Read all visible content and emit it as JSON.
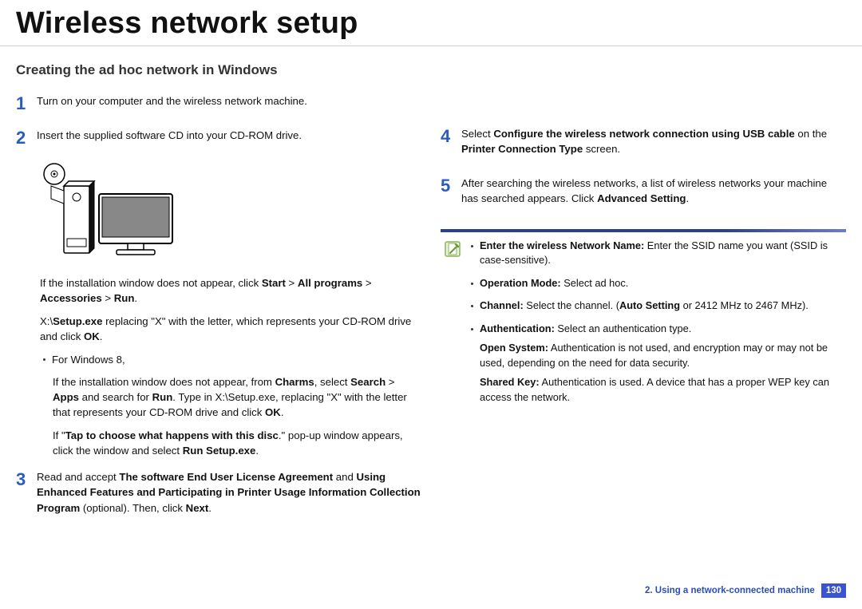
{
  "title": "Wireless network setup",
  "subheading": "Creating the ad hoc network in Windows",
  "left": {
    "step1": {
      "num": "1",
      "text": "Turn on your computer and the wireless network machine."
    },
    "step2": {
      "num": "2",
      "text": "Insert the supplied software CD into your CD-ROM drive."
    },
    "afterInstall_pre": "If the installation window does not appear, click ",
    "afterInstall_bold1": "Start",
    "gt": " > ",
    "afterInstall_bold2": "All programs",
    "afterInstall_bold3": "Accessories",
    "afterInstall_bold4": "Run",
    "period": ".",
    "setupexe_pre": " X:\\",
    "setupexe_bold": "Setup.exe",
    "setupexe_post": " replacing \"X\" with the letter, which represents your CD-ROM drive and click ",
    "ok": "OK",
    "win8_label": "For Windows 8,",
    "win8_p1_a": "If the installation window does not appear, from ",
    "win8_p1_b": "Charms",
    "win8_p1_c": ", select ",
    "win8_p1_d": "Search",
    "win8_p1_e": "Apps",
    "win8_p1_f": " and search for ",
    "win8_p1_g": "Run",
    "win8_p1_h": ". Type in X:\\Setup.exe, replacing \"X\" with the letter that represents your CD-ROM drive and click ",
    "win8_p2_a": "If \"",
    "win8_p2_b": "Tap to choose what happens with this disc",
    "win8_p2_c": ".\" pop-up window appears, click the window and select ",
    "win8_p2_d": "Run Setup.exe",
    "step3": {
      "num": "3",
      "a": "Read and accept ",
      "b": "The software End User License Agreement",
      "c": "  and ",
      "d": "Using Enhanced Features and Participating in Printer Usage Information Collection Program",
      "e": " (optional). Then, click ",
      "f": "Next"
    }
  },
  "right": {
    "step4": {
      "num": "4",
      "a": "Select ",
      "b": "Configure the wireless network connection using USB cable",
      "c": " on the ",
      "d": "Printer Connection Type",
      "e": " screen."
    },
    "step5": {
      "num": "5",
      "a": "After searching the wireless networks, a list of wireless networks your machine has searched appears. Click ",
      "b": "Advanced Setting"
    },
    "note": {
      "n1a": "Enter the wireless Network Name:",
      "n1b": " Enter the SSID name you want (SSID is case-sensitive).",
      "n2a": "Operation Mode:",
      "n2b": " Select ad hoc.",
      "n3a": "Channel:",
      "n3b": " Select the channel. (",
      "n3c": "Auto Setting",
      "n3d": " or 2412 MHz to 2467 MHz).",
      "n4a": "Authentication:",
      "n4b": " Select an authentication type.",
      "n5a": "Open System:",
      "n5b": " Authentication is not used, and encryption may or may not be used, depending on the need for data security.",
      "n6a": "Shared Key:",
      "n6b": " Authentication is used. A device that has a proper WEP key can access the network."
    }
  },
  "footer": {
    "chapter": "2.  Using a network-connected machine",
    "page": "130"
  }
}
